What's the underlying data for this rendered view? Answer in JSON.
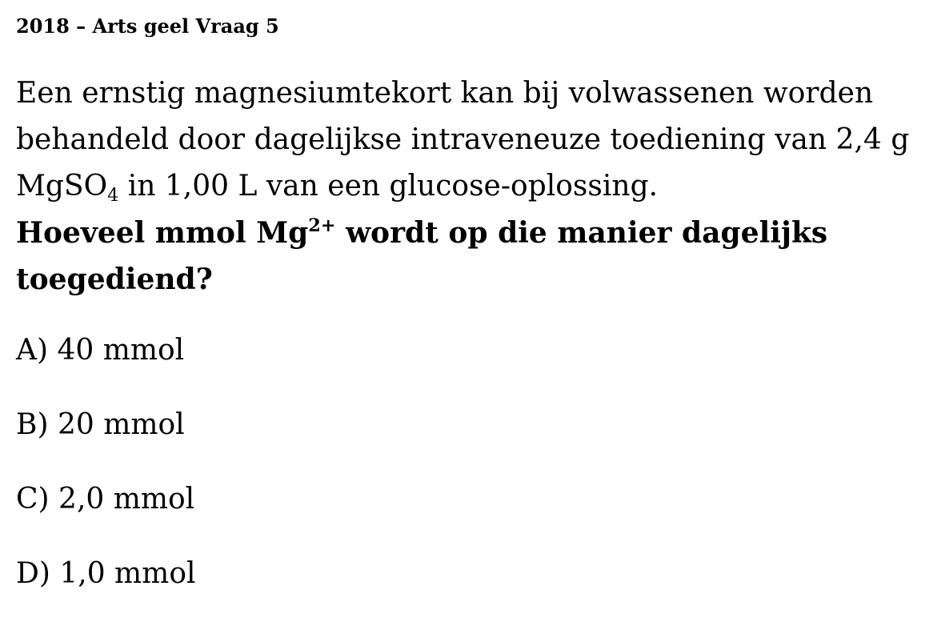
{
  "header": {
    "title": "2018 – Arts geel Vraag 5"
  },
  "intro": {
    "line1": "Een ernstig magnesiumtekort kan bij volwassenen worden",
    "line2": "behandeld door dagelijkse intraveneuze toediening van 2,4 g",
    "line3_formula_base": "MgSO",
    "line3_formula_sub": "4",
    "line3_rest": " in 1,00 L van een glucose-oplossing."
  },
  "question": {
    "part1": "Hoeveel mmol Mg",
    "ion_charge": "2+",
    "part2": " wordt op die manier dagelijks",
    "line2": "toegediend?"
  },
  "options": [
    {
      "label": "A) 40 mmol"
    },
    {
      "label": "B) 20 mmol"
    },
    {
      "label": "C) 2,0 mmol"
    },
    {
      "label": "D) 1,0 mmol"
    }
  ]
}
